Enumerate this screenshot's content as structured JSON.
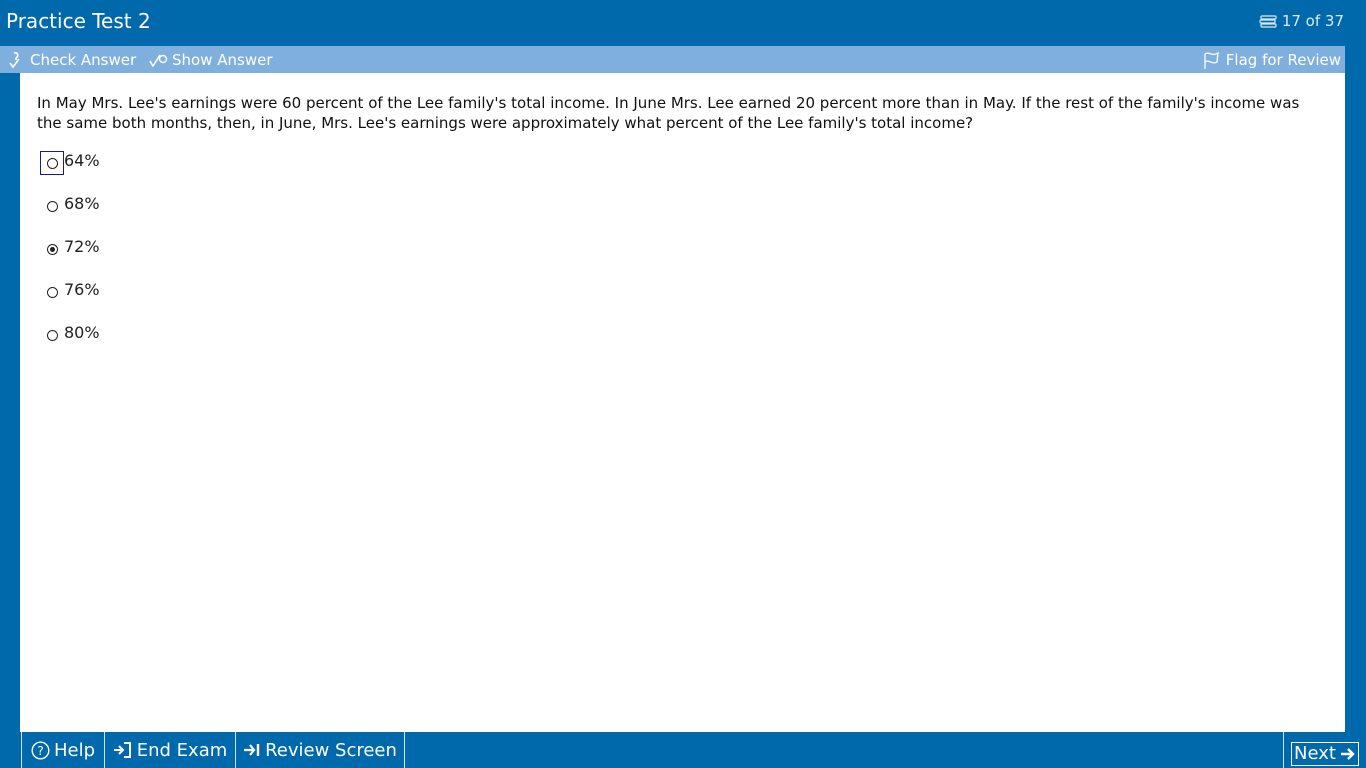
{
  "header": {
    "title": "Practice Test 2",
    "counter_text": "17 of 37",
    "counter_icon": "list-icon"
  },
  "toolbar": {
    "check_answer": "Check Answer",
    "show_answer": "Show Answer",
    "flag_for_review": "Flag for Review"
  },
  "question": {
    "text": "In May Mrs. Lee's earnings were 60 percent of the Lee family's total income.  In June Mrs. Lee earned 20 percent more than in May.  If the rest of the family's income was the same both months, then, in June, Mrs. Lee's earnings were approximately what percent of the Lee family's total income?",
    "choices": [
      {
        "label": "64%",
        "selected": false,
        "focused": true
      },
      {
        "label": "68%",
        "selected": false,
        "focused": false
      },
      {
        "label": "72%",
        "selected": true,
        "focused": false
      },
      {
        "label": "76%",
        "selected": false,
        "focused": false
      },
      {
        "label": "80%",
        "selected": false,
        "focused": false
      }
    ]
  },
  "footer": {
    "help": "Help",
    "end_exam": "End Exam",
    "review_screen": "Review Screen",
    "next": "Next"
  },
  "colors": {
    "primary": "#0069ab",
    "toolbar": "#7fb0dd",
    "content_bg": "#ffffff"
  }
}
